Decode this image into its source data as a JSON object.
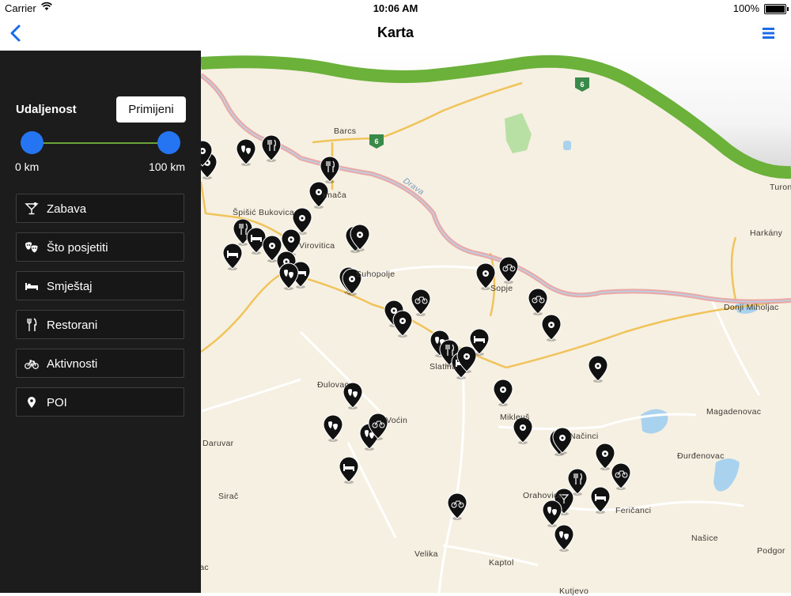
{
  "status_bar": {
    "carrier": "Carrier",
    "time": "10:06 AM",
    "battery": "100%"
  },
  "nav": {
    "title": "Karta",
    "back_icon": "chevron-left-icon",
    "menu_icon": "hamburger-menu-icon",
    "accent": "#1a6be8"
  },
  "filter": {
    "distance_label": "Udaljenost",
    "apply_label": "Primijeni",
    "range": {
      "min_label": "0 km",
      "max_label": "100 km",
      "min_km": 0,
      "max_km": 100
    },
    "knob_color": "#2575f3",
    "categories": [
      {
        "label": "Zabava",
        "icon": "cocktail-icon"
      },
      {
        "label": "Što posjetiti",
        "icon": "theater-masks-icon"
      },
      {
        "label": "Smještaj",
        "icon": "bed-icon"
      },
      {
        "label": "Restorani",
        "icon": "fork-knife-icon"
      },
      {
        "label": "Aktivnosti",
        "icon": "bicycle-icon"
      },
      {
        "label": "POI",
        "icon": "location-pin-icon"
      }
    ]
  },
  "map": {
    "road_shield": "6",
    "places": [
      "Barcs",
      "Špišić Bukovica",
      "Virovitica",
      "Suhopolje",
      "Sopje",
      "Slatina",
      "Đulovac",
      "Voćin",
      "Daruvar",
      "Sirač",
      "Mikleuš",
      "Načinci",
      "Orahovica",
      "Feričanci",
      "Magadenovac",
      "Đurđenovac",
      "Donji Miholjac",
      "Harkány",
      "Turon",
      "Našice",
      "Podgor",
      "Velika",
      "Kaptol",
      "Kutjevo",
      "Drava",
      "Pitomača",
      "Lac"
    ]
  }
}
